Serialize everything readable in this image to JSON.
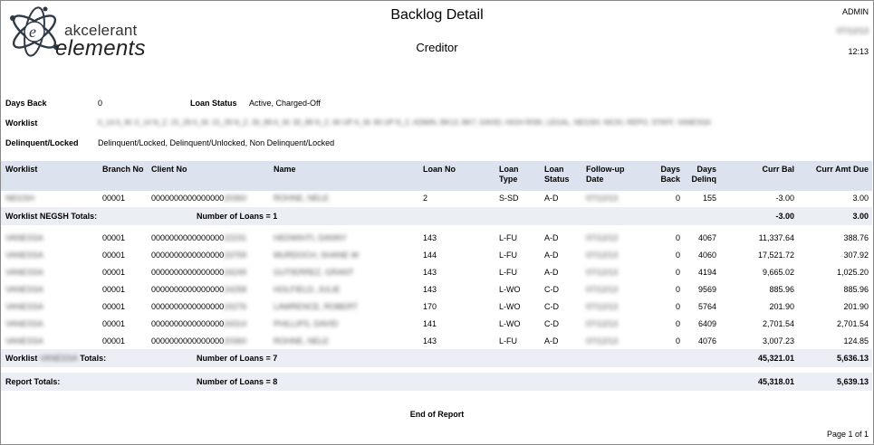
{
  "header": {
    "brand_top": "akcelerant",
    "brand_bottom": "elements",
    "title": "Backlog Detail",
    "subtitle": "Creditor",
    "user": "ADMIN",
    "date": "07/12/13",
    "time": "12:13"
  },
  "params": {
    "days_back_label": "Days Back",
    "days_back_value": "0",
    "loan_status_label": "Loan Status",
    "loan_status_value": "Active, Charged-Off",
    "worklist_label": "Worklist",
    "worklist_value": "0_14 A_W, 0_14 N_Z, 15_29 A_W, 15_29 N_Z, 30_89 A_W, 30_89 N_Z, 90 UP A_W, 90 UP N_Z, ADMIN, BK13, BK7, DAVID, HIGH RISK, LEGAL, NEGSH, NICKI, REPO, STAFF, VANESSA",
    "delinquent_label": "Delinquent/Locked",
    "delinquent_value": "Delinquent/Locked, Delinquent/Unlocked, Non Delinquent/Locked"
  },
  "table": {
    "columns": {
      "worklist": "Worklist",
      "branch": "Branch No",
      "client": "Client No",
      "name": "Name",
      "loan_no": "Loan No",
      "loan_type_1": "Loan",
      "loan_type_2": "Type",
      "loan_status_1": "Loan",
      "loan_status_2": "Status",
      "followup_1": "Follow-up",
      "followup_2": "Date",
      "days_back_1": "Days",
      "days_back_2": "Back",
      "days_delinq_1": "Days",
      "days_delinq_2": "Delinq",
      "curr_bal": "Curr Bal",
      "curr_amt_due": "Curr Amt Due"
    },
    "group1_rows": [
      {
        "worklist": "NEGSH",
        "branch": "00001",
        "client": "0000000000000000",
        "client_tail": "20360",
        "name": "ROHNE, NELE",
        "loan_no": "2",
        "loan_type": "S-SD",
        "status": "A-D",
        "followup": "07/12/13",
        "days_back": "0",
        "days_delinq": "155",
        "curr_bal": "-3.00",
        "curr_due": "3.00"
      }
    ],
    "group1_total": {
      "label": "Worklist NEGSH Totals:",
      "loans": "Number of Loans = 1",
      "curr_bal": "-3.00",
      "curr_due": "3.00"
    },
    "group2_rows": [
      {
        "worklist": "VANESSA",
        "branch": "00001",
        "client": "0000000000000000",
        "client_tail": "22231",
        "name": "HEDWIHTI, DANNY",
        "loan_no": "143",
        "loan_type": "L-FU",
        "status": "A-D",
        "followup": "07/12/13",
        "days_back": "0",
        "days_delinq": "4067",
        "curr_bal": "11,337.64",
        "curr_due": "388.76"
      },
      {
        "worklist": "VANESSA",
        "branch": "00001",
        "client": "0000000000000000",
        "client_tail": "23759",
        "name": "MURDOCH, SHANE W",
        "loan_no": "144",
        "loan_type": "L-FU",
        "status": "A-D",
        "followup": "07/12/13",
        "days_back": "0",
        "days_delinq": "4060",
        "curr_bal": "17,521.72",
        "curr_due": "307.92"
      },
      {
        "worklist": "VANESSA",
        "branch": "00001",
        "client": "0000000000000000",
        "client_tail": "24249",
        "name": "GUTIERREZ, GRANT",
        "loan_no": "143",
        "loan_type": "L-FU",
        "status": "A-D",
        "followup": "07/12/13",
        "days_back": "0",
        "days_delinq": "4194",
        "curr_bal": "9,665.02",
        "curr_due": "1,025.20"
      },
      {
        "worklist": "VANESSA",
        "branch": "00001",
        "client": "0000000000000000",
        "client_tail": "24258",
        "name": "HOLFIELD, JULIE",
        "loan_no": "143",
        "loan_type": "L-WO",
        "status": "C-D",
        "followup": "07/12/13",
        "days_back": "0",
        "days_delinq": "9569",
        "curr_bal": "885.96",
        "curr_due": "885.96"
      },
      {
        "worklist": "VANESSA",
        "branch": "00001",
        "client": "0000000000000000",
        "client_tail": "24276",
        "name": "LAWRENCE, ROBERT",
        "loan_no": "170",
        "loan_type": "L-WO",
        "status": "C-D",
        "followup": "07/12/13",
        "days_back": "0",
        "days_delinq": "5764",
        "curr_bal": "201.90",
        "curr_due": "201.90"
      },
      {
        "worklist": "VANESSA",
        "branch": "00001",
        "client": "0000000000000000",
        "client_tail": "24314",
        "name": "PHILLIPS, DAVID",
        "loan_no": "141",
        "loan_type": "L-WO",
        "status": "C-D",
        "followup": "07/12/13",
        "days_back": "0",
        "days_delinq": "6409",
        "curr_bal": "2,701.54",
        "curr_due": "2,701.54"
      },
      {
        "worklist": "VANESSA",
        "branch": "00001",
        "client": "0000000000000000",
        "client_tail": "20360",
        "name": "ROHNE, NELE",
        "loan_no": "143",
        "loan_type": "L-FU",
        "status": "A-D",
        "followup": "07/12/13",
        "days_back": "0",
        "days_delinq": "4076",
        "curr_bal": "3,007.23",
        "curr_due": "124.85"
      }
    ],
    "group2_total": {
      "label_pre": "Worklist",
      "label_mid": "VANESSA",
      "label_post": "Totals:",
      "loans": "Number of Loans = 7",
      "curr_bal": "45,321.01",
      "curr_due": "5,636.13"
    },
    "report_total": {
      "label": "Report Totals:",
      "loans": "Number of Loans = 8",
      "curr_bal": "45,318.01",
      "curr_due": "5,639.13"
    }
  },
  "footer": {
    "end": "End of Report",
    "page": "Page 1 of 1"
  },
  "colors": {
    "header_band": "#dde3ee",
    "total_band": "#ebeef5",
    "logo_accent": "#2f3a47"
  }
}
